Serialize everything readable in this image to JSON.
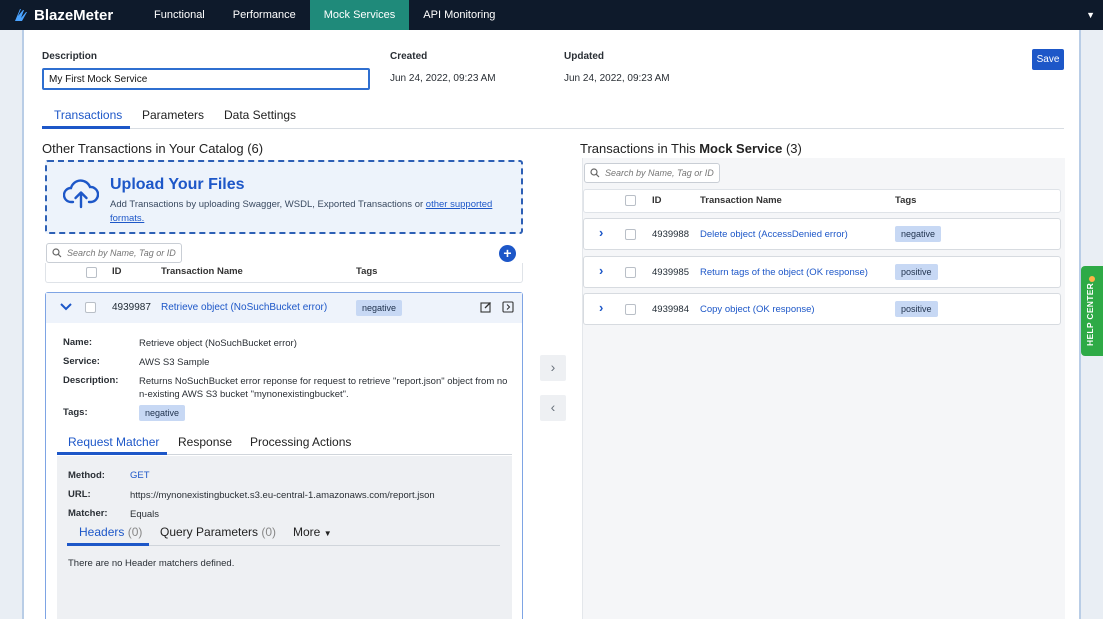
{
  "app": {
    "name": "BlazeMeter"
  },
  "nav": {
    "tabs": [
      {
        "label": "Functional"
      },
      {
        "label": "Performance"
      },
      {
        "label": "Mock Services",
        "active": true
      },
      {
        "label": "API Monitoring"
      }
    ]
  },
  "form": {
    "description_label": "Description",
    "description_value": "My First Mock Service",
    "created_label": "Created",
    "created_value": "Jun 24, 2022, 09:23 AM",
    "updated_label": "Updated",
    "updated_value": "Jun 24, 2022, 09:23 AM",
    "save_label": "Save"
  },
  "tabs": [
    {
      "label": "Transactions",
      "active": true
    },
    {
      "label": "Parameters"
    },
    {
      "label": "Data Settings"
    }
  ],
  "catalog": {
    "title": "Other Transactions in Your Catalog (6)",
    "upload": {
      "title": "Upload Your Files",
      "text": "Add Transactions by uploading Swagger, WSDL, Exported Transactions or ",
      "link": "other supported formats."
    },
    "search_placeholder": "Search by Name, Tag or ID",
    "columns": {
      "id": "ID",
      "name": "Transaction Name",
      "tags": "Tags"
    },
    "expanded": {
      "id": "4939987",
      "name": "Retrieve object (NoSuchBucket error)",
      "tag": "negative",
      "details": {
        "name_label": "Name:",
        "name_value": "Retrieve object (NoSuchBucket error)",
        "service_label": "Service:",
        "service_value": "AWS S3 Sample",
        "description_label": "Description:",
        "description_value": "Returns NoSuchBucket error reponse for request to retrieve \"report.json\" object from non-existing AWS S3 bucket \"mynonexistingbucket\".",
        "tags_label": "Tags:",
        "tags_value": "negative"
      },
      "subtabs": [
        {
          "label": "Request Matcher",
          "active": true
        },
        {
          "label": "Response"
        },
        {
          "label": "Processing Actions"
        }
      ],
      "request": {
        "method_label": "Method:",
        "method_value": "GET",
        "url_label": "URL:",
        "url_value": "https://mynonexistingbucket.s3.eu-central-1.amazonaws.com/report.json",
        "matcher_label": "Matcher:",
        "matcher_value": "Equals"
      },
      "inner_tabs": {
        "headers": "Headers",
        "headers_count": "(0)",
        "query": "Query Parameters",
        "query_count": "(0)",
        "more": "More"
      },
      "empty_message": "There are no Header matchers defined."
    }
  },
  "mock": {
    "title_prefix": "Transactions in This ",
    "title_bold": "Mock Service",
    "title_suffix": " (3)",
    "search_placeholder": "Search by Name, Tag or ID",
    "columns": {
      "id": "ID",
      "name": "Transaction Name",
      "tags": "Tags"
    },
    "rows": [
      {
        "id": "4939988",
        "name": "Delete object (AccessDenied error)",
        "tag": "negative"
      },
      {
        "id": "4939985",
        "name": "Return tags of the object (OK response)",
        "tag": "positive"
      },
      {
        "id": "4939984",
        "name": "Copy object (OK response)",
        "tag": "positive"
      }
    ]
  },
  "help": {
    "label": "HELP CENTER"
  },
  "colors": {
    "brand": "#1d57c8",
    "nav_bg": "#0e1a2b",
    "active_nav": "#1f8a7a",
    "help": "#2eaa46"
  }
}
